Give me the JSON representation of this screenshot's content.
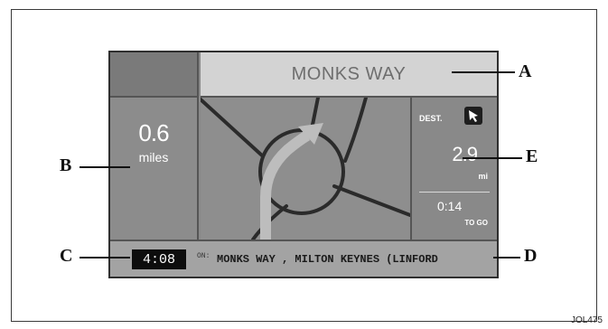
{
  "screen": {
    "street_name": "MONKS WAY",
    "left_panel": {
      "distance": "0.6",
      "unit": "miles"
    },
    "right_panel": {
      "dest_label": "DEST.",
      "dest_icon": "arrow-pointer-icon",
      "distance": "2.9",
      "unit": "mi",
      "time": "0:14",
      "time_label": "TO GO"
    },
    "bottom_bar": {
      "clock": "4:08",
      "on_label": "ON:",
      "road": "MONKS WAY , MILTON KEYNES (LINFORD"
    }
  },
  "callouts": {
    "a": "A",
    "b": "B",
    "c": "C",
    "d": "D",
    "e": "E"
  },
  "figure_code": "JOL475",
  "colors": {
    "map_road": "#2f2f2f",
    "route_arrow": "#bdbdbd",
    "screen_bg": "#8a8a8a"
  }
}
